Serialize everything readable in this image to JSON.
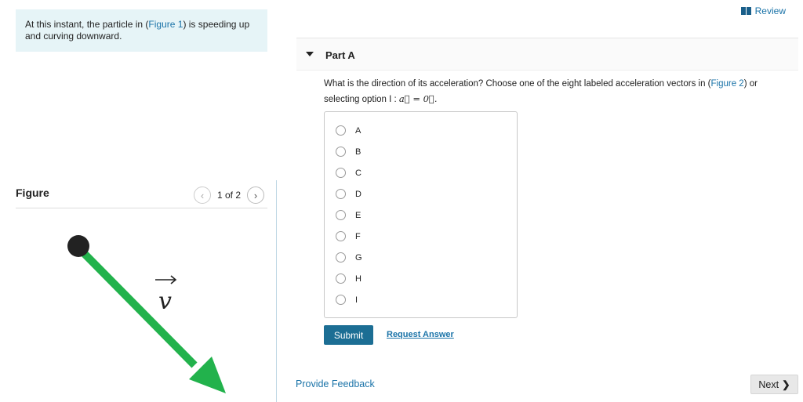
{
  "intro": {
    "text_before": "At this instant, the particle in (",
    "link": "Figure 1",
    "text_after": ") is speeding up and curving downward."
  },
  "figure": {
    "title": "Figure",
    "pager": "1 of 2",
    "prev_icon": "chevron-left-icon",
    "next_icon": "chevron-right-icon",
    "vector_label": "v",
    "arrow_color": "#22b24c"
  },
  "header": {
    "review_label": "Review",
    "review_icon": "book-icon"
  },
  "part": {
    "title": "Part A"
  },
  "question": {
    "text_before": "What is the direction of its acceleration? Choose one of the eight labeled acceleration vectors in (",
    "link": "Figure 2",
    "text_after": ") or selecting option I : ",
    "formula": "a⃗ = 0⃗."
  },
  "options": [
    "A",
    "B",
    "C",
    "D",
    "E",
    "F",
    "G",
    "H",
    "I"
  ],
  "actions": {
    "submit_label": "Submit",
    "request_label": "Request Answer",
    "feedback_label": "Provide Feedback",
    "next_label": "Next"
  },
  "colors": {
    "accent": "#1c6e94",
    "link": "#1a73a8",
    "intro_bg": "#e6f4f7"
  }
}
